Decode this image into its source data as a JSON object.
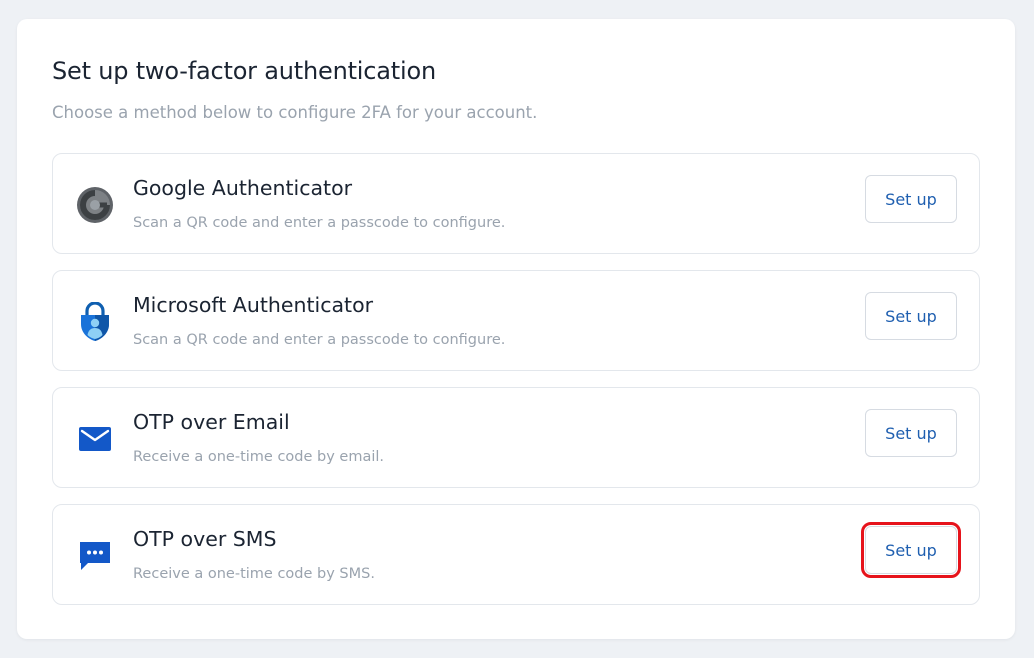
{
  "page": {
    "title": "Set up two-factor authentication",
    "subtitle": "Choose a method below to configure 2FA for your account."
  },
  "methods": [
    {
      "name": "Google Authenticator",
      "description": "Scan a QR code and enter a passcode to configure.",
      "icon": "google-authenticator-icon",
      "button_label": "Set up"
    },
    {
      "name": "Microsoft Authenticator",
      "description": "Scan a QR code and enter a passcode to configure.",
      "icon": "microsoft-authenticator-icon",
      "button_label": "Set up"
    },
    {
      "name": "OTP over Email",
      "description": "Receive a one-time code by email.",
      "icon": "mail-icon",
      "button_label": "Set up"
    },
    {
      "name": "OTP over SMS",
      "description": "Receive a one-time code by SMS.",
      "icon": "sms-icon",
      "button_label": "Set up",
      "highlighted": true
    }
  ],
  "colors": {
    "background": "#eef1f5",
    "card": "#ffffff",
    "title_text": "#1b2432",
    "muted_text": "#9aa3ae",
    "button_text": "#1f5fb0",
    "icon_blue": "#1358c8",
    "highlight": "#e6131b"
  }
}
